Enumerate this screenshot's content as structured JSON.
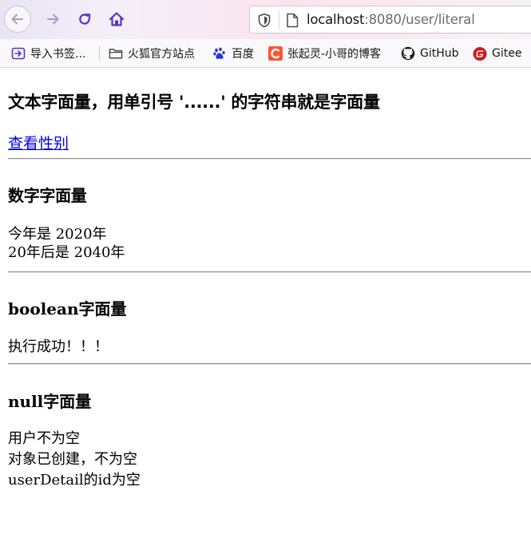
{
  "browser": {
    "url_host": "localhost",
    "url_rest": ":8080/user/literal",
    "bookmarks": [
      {
        "label": "导入书签...",
        "icon": "import-icon"
      },
      {
        "label": "火狐官方站点",
        "icon": "folder-icon"
      },
      {
        "label": "百度",
        "icon": "baidu-paw-icon"
      },
      {
        "label": "张起灵-小哥的博客",
        "icon": "csdn-c-icon"
      },
      {
        "label": "GitHub",
        "icon": "github-icon"
      },
      {
        "label": "Gitee",
        "icon": "gitee-icon"
      }
    ],
    "colors": {
      "nav_accent": "#5b2fc9",
      "csdn": "#fc5531",
      "gitee": "#c71d23",
      "link": "#0000ee"
    }
  },
  "page": {
    "section1": {
      "heading": "文本字面量，用单引号 '......' 的字符串就是字面量",
      "link": "查看性别"
    },
    "section2": {
      "heading": "数字字面量",
      "line1": "今年是 2020年",
      "line2": "20年后是 2040年"
    },
    "section3": {
      "heading": "boolean字面量",
      "line1": "执行成功！！！"
    },
    "section4": {
      "heading": "null字面量",
      "line1": "用户不为空",
      "line2": "对象已创建，不为空",
      "line3": "userDetail的id为空"
    }
  }
}
